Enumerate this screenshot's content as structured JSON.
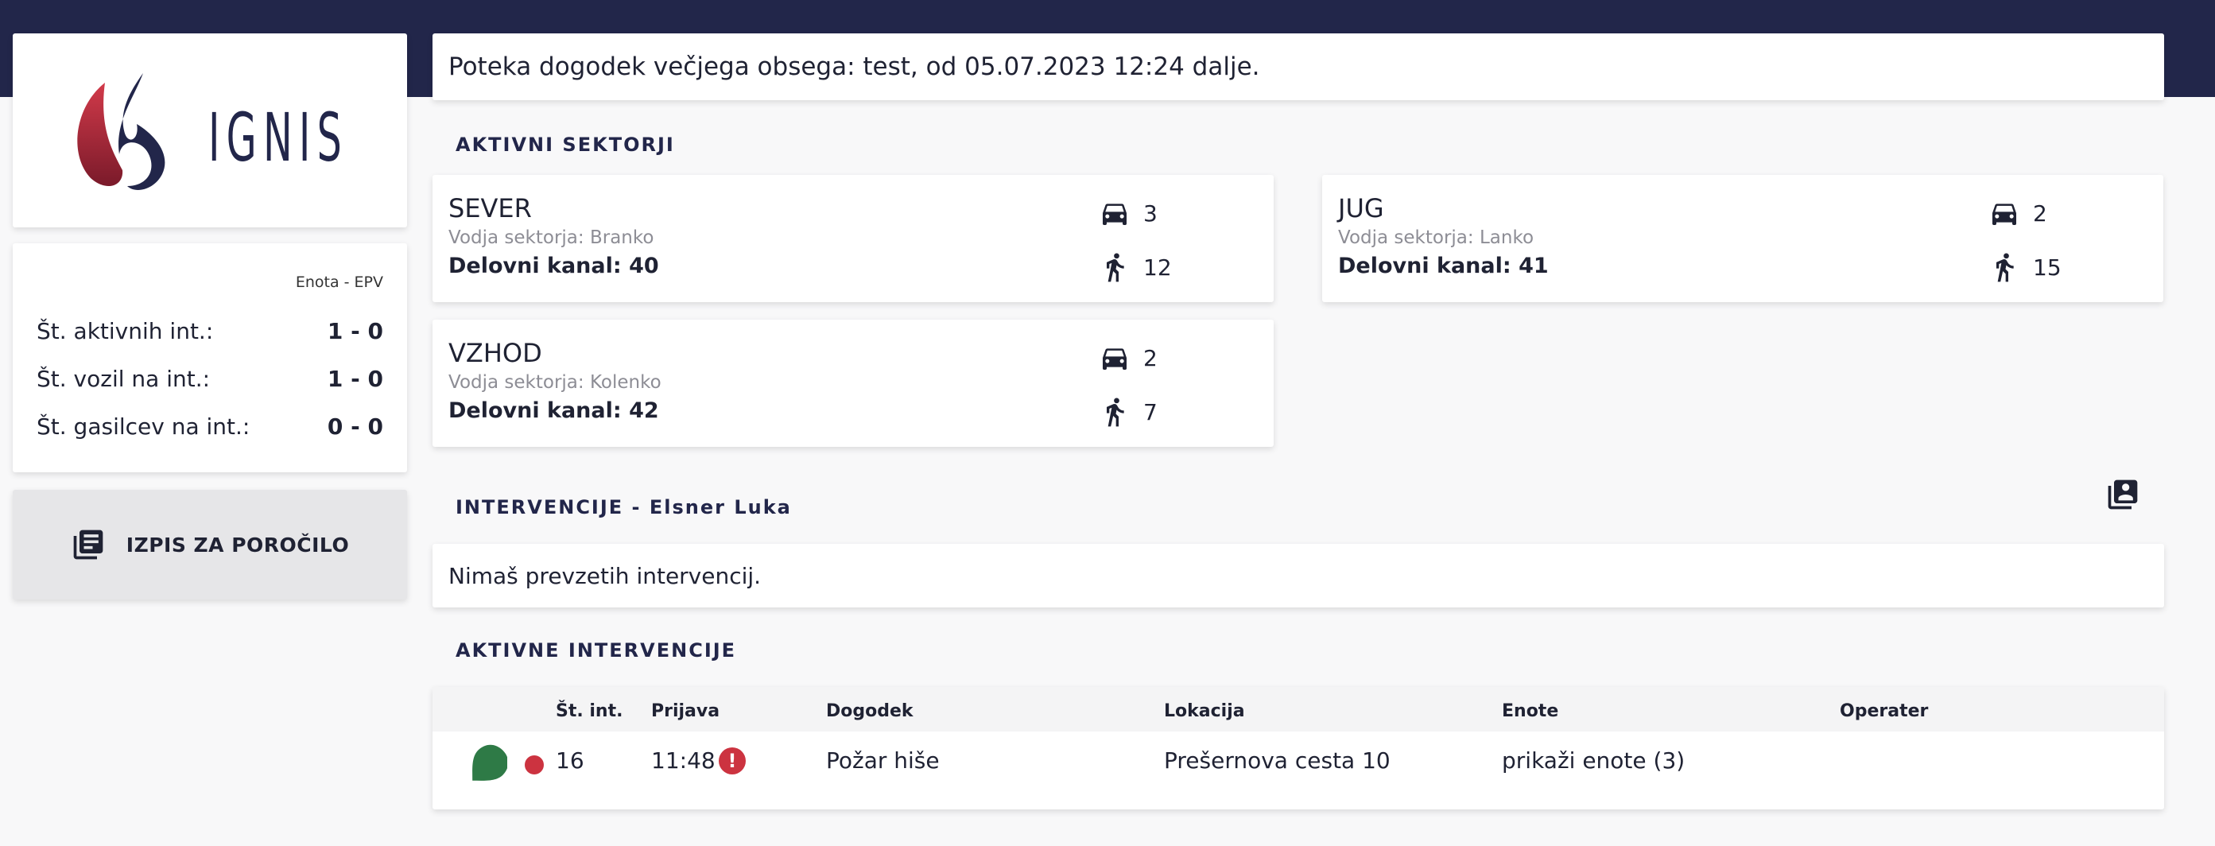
{
  "brand": {
    "logo_text": "IGNIS",
    "colors": {
      "navy": "#22264a",
      "flame_red": "#c0283a",
      "marker_green": "#2e7a46",
      "status_red": "#cc3340"
    }
  },
  "page_title": "Poteka dogodek večjega obsega: test, od 05.07.2023 12:24 dalje.",
  "stats": {
    "unit_label": "Enota - EPV",
    "rows": [
      {
        "label": "Št. aktivnih int.:",
        "value": "1 - 0"
      },
      {
        "label": "Št. vozil na int.:",
        "value": "1 - 0"
      },
      {
        "label": "Št. gasilcev na int.:",
        "value": "0 - 0"
      }
    ]
  },
  "report_button": {
    "label": "IZPIS ZA POROČILO",
    "icon": "report-list-icon"
  },
  "sectors_section": {
    "title": "AKTIVNI SEKTORJI",
    "items": [
      {
        "name": "SEVER",
        "leader": "Vodja sektorja: Branko",
        "channel": "Delovni kanal: 40",
        "vehicles": "3",
        "firefighters": "12"
      },
      {
        "name": "JUG",
        "leader": "Vodja sektorja: Lanko",
        "channel": "Delovni kanal: 41",
        "vehicles": "2",
        "firefighters": "15"
      },
      {
        "name": "VZHOD",
        "leader": "Vodja sektorja: Kolenko",
        "channel": "Delovni kanal: 42",
        "vehicles": "2",
        "firefighters": "7"
      }
    ]
  },
  "my_interventions": {
    "title": "INTERVENCIJE - Elsner Luka",
    "empty_text": "Nimaš prevzetih intervencij.",
    "action_icon": "assignment-icon"
  },
  "active_interventions": {
    "title": "AKTIVNE INTERVENCIJE",
    "columns": [
      "Št. int.",
      "Prijava",
      "Dogodek",
      "Lokacija",
      "Enote",
      "Operater"
    ],
    "rows": [
      {
        "number": "16",
        "reported": "11:48",
        "event": "Požar hiše",
        "location": "Prešernova cesta 10",
        "units": "prikaži enote (3)",
        "operator": "",
        "marker_icon": "map-marker-icon",
        "status_icon": "status-dot-icon",
        "alert_icon": "alert-icon"
      }
    ]
  }
}
